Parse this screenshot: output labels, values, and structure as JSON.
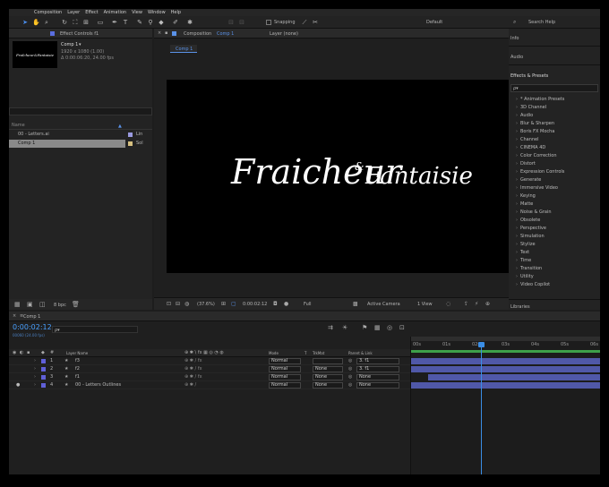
{
  "menubar": [
    "Composition",
    "Layer",
    "Effect",
    "Animation",
    "View",
    "Window",
    "Help"
  ],
  "toolbar": {
    "snapping_label": "Snapping",
    "workspace": "Default",
    "search_placeholder": "Search Help"
  },
  "project_panel": {
    "tab_label": "Effect Controls f1",
    "comp_name": "Comp 1",
    "comp_dims": "1920 x 1080 (1.00)",
    "comp_duration": "Δ 0:00:06:20, 24.00 fps",
    "thumb_text": "Fraîcheur&Fantaisie",
    "col_name": "Name",
    "items": [
      {
        "name": "00 - Letters.ai",
        "type": "Lin"
      },
      {
        "name": "Comp 1",
        "type": "Sol"
      }
    ],
    "bpc": "8 bpc"
  },
  "comp_panel": {
    "tab_label": "Composition",
    "tab_comp": "Comp 1",
    "layer_tab": "Layer (none)",
    "sub_tab": "Comp 1",
    "title_main": "Fraicheur",
    "title_amp": "&",
    "title_second": "Fantaisie",
    "zoom": "(37.6%)",
    "timecode": "0:00:02:12",
    "resolution": "Full",
    "camera": "Active Camera",
    "view": "1 View"
  },
  "right_panel": {
    "info": "Info",
    "audio": "Audio",
    "effects_title": "Effects & Presets",
    "search_placeholder": "ρ▾",
    "effects": [
      "* Animation Presets",
      "3D Channel",
      "Audio",
      "Blur & Sharpen",
      "Boris FX Mocha",
      "Channel",
      "CINEMA 4D",
      "Color Correction",
      "Distort",
      "Expression Controls",
      "Generate",
      "Immersive Video",
      "Keying",
      "Matte",
      "Noise & Grain",
      "Obsolete",
      "Perspective",
      "Simulation",
      "Stylize",
      "Text",
      "Time",
      "Transition",
      "Utility",
      "Video Copilot"
    ],
    "libraries": "Libraries"
  },
  "timeline": {
    "tab_label": "Comp 1",
    "timecode": "0:00:02:12",
    "frames": "00060 (24.00 fps)",
    "search_placeholder": "ρ▾",
    "col_layer": "Layer Name",
    "col_mode": "Mode",
    "col_t": "T",
    "col_trkmat": "TrkMat",
    "col_parent": "Parent & Link",
    "ruler": [
      "00s",
      "01s",
      "02s",
      "03s",
      "04s",
      "05s",
      "06s"
    ],
    "playhead_fraction": 0.37,
    "layers": [
      {
        "num": "1",
        "name": "f3",
        "mode": "Normal",
        "trkmat": "",
        "parent": "3. f1",
        "start_fraction": 0.0
      },
      {
        "num": "2",
        "name": "f2",
        "mode": "Normal",
        "trkmat": "None",
        "parent": "3. f1",
        "start_fraction": 0.0
      },
      {
        "num": "3",
        "name": "f1",
        "mode": "Normal",
        "trkmat": "None",
        "parent": "None",
        "start_fraction": 0.09
      },
      {
        "num": "4",
        "name": "00 - Letters Outlines",
        "mode": "Normal",
        "trkmat": "None",
        "parent": "None",
        "start_fraction": 0.0
      }
    ]
  }
}
